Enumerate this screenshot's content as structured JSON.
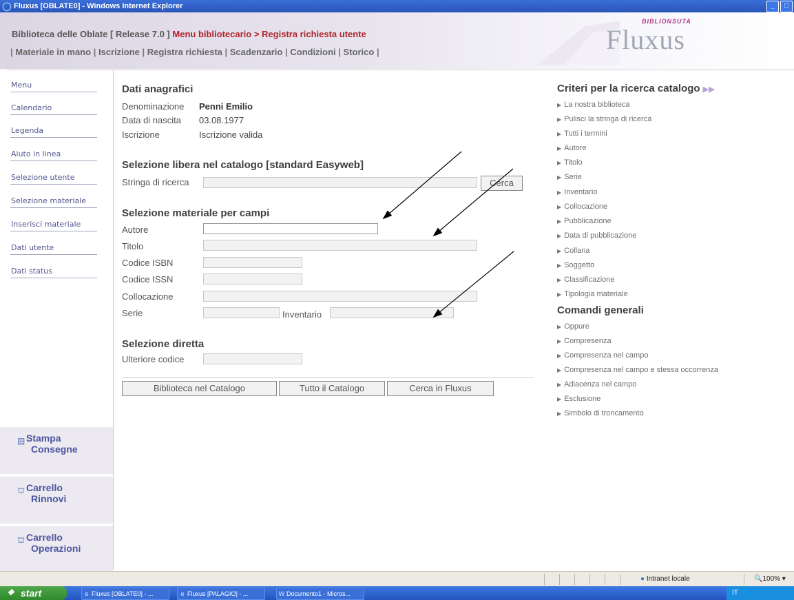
{
  "window": {
    "title": "Fluxus [OBLATE0] - Windows Internet Explorer"
  },
  "header": {
    "title_prefix": "Biblioteca delle Oblate [ Release 7.0 ]",
    "title_section": "Menu bibliotecario > Registra richiesta utente",
    "nav": [
      "Materiale in mano",
      "Iscrizione",
      "Registra richiesta",
      "Scadenzario",
      "Condizioni",
      "Storico"
    ],
    "brand_sub": "BIBLIONSUTA",
    "brand_name": "Fluxus"
  },
  "leftmenu": {
    "items": [
      "Menu",
      "Calendario",
      "Legenda",
      "Aiuto in linea",
      "Selezione utente",
      "Selezione materiale",
      "Inserisci materiale",
      "Dati utente",
      "Dati status"
    ],
    "boxes": [
      {
        "line1": "Stampa",
        "line2": "Consegne",
        "icon": "printer-icon"
      },
      {
        "line1": "Carrello",
        "line2": "Rinnovi",
        "icon": "cart-icon"
      },
      {
        "line1": "Carrello",
        "line2": "Operazioni",
        "icon": "cart-icon"
      }
    ]
  },
  "anagrafici": {
    "title": "Dati anagrafici",
    "denominazione_label": "Denominazione",
    "denominazione_value": "Penni Emilio",
    "nascita_label": "Data di nascita",
    "nascita_value": "03.08.1977",
    "iscrizione_label": "Iscrizione",
    "iscrizione_value": "Iscrizione valida"
  },
  "libera": {
    "title": "Selezione libera nel catalogo [standard Easyweb]",
    "stringa_label": "Stringa di ricerca",
    "stringa_value": "",
    "cerca_label": "Cerca"
  },
  "campi": {
    "title": "Selezione materiale per campi",
    "autore_label": "Autore",
    "titolo_label": "Titolo",
    "isbn_label": "Codice ISBN",
    "issn_label": "Codice ISSN",
    "collocazione_label": "Collocazione",
    "serie_label": "Serie",
    "inventario_label": "Inventario"
  },
  "diretta": {
    "title": "Selezione diretta",
    "codice_label": "Ulteriore codice"
  },
  "actions": {
    "biblioteca": "Biblioteca nel Catalogo",
    "tutto": "Tutto il Catalogo",
    "fluxus": "Cerca in Fluxus"
  },
  "right": {
    "criteri_title": "Criteri per la ricerca catalogo",
    "criteri_items": [
      "La nostra biblioteca",
      "Pulisci la stringa di ricerca",
      "Tutti i termini",
      "Autore",
      "Titolo",
      "Serie",
      "Inventario",
      "Collocazione",
      "Pubblicazione",
      "Data di pubblicazione",
      "Collana",
      "Soggetto",
      "Classificazione",
      "Tipologia materiale"
    ],
    "comandi_title": "Comandi generali",
    "comandi_items": [
      "Oppure",
      "Compresenza",
      "Compresenza nel campo",
      "Compresenza nel campo e stessa occorrenza",
      "Adiacenza nel campo",
      "Esclusione",
      "Simbolo di troncamento"
    ]
  },
  "statusbar": {
    "zone": "Intranet locale",
    "zoom": "100%"
  },
  "taskbar": {
    "start": "start",
    "tasks": [
      "Fluxus [OBLATE0] - ...",
      "Fluxus [PALAGIO] - ...",
      "Documento1 - Micros..."
    ],
    "tray_lang": "IT"
  },
  "colors": {
    "accent_red": "#b0252b",
    "menu_link": "#52558e",
    "brand_gray": "#9fa8b3",
    "titlebar_blue": "#2a55b8"
  }
}
